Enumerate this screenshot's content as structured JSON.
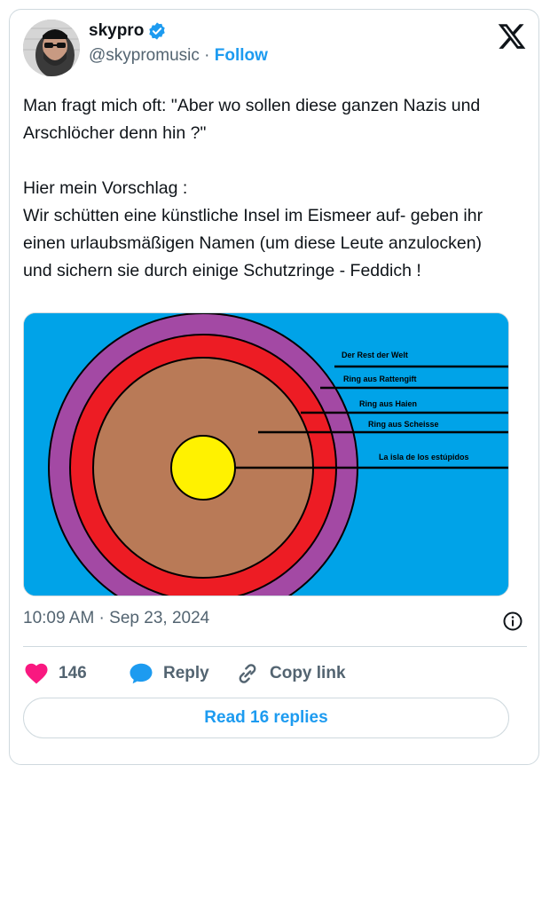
{
  "author": {
    "name": "skypro",
    "handle": "@skypromusic",
    "separator": "·",
    "follow_label": "Follow"
  },
  "tweet": {
    "text": "Man fragt mich oft: \"Aber wo sollen diese ganzen Nazis und Arschlöcher denn hin ?\"\n\nHier mein Vorschlag :\nWir schütten eine künstliche Insel im Eismeer auf- geben ihr einen urlaubsmäßigen Namen (um diese Leute anzulocken) und sichern sie durch einige Schutzringe - Feddich !",
    "timestamp": "10:09 AM · Sep 23, 2024"
  },
  "media": {
    "labels": {
      "world": "Der Rest der Welt",
      "rat_poison": "Ring aus Rattengift",
      "sharks": "Ring aus Haien",
      "shit": "Ring aus Scheisse",
      "island": "La isla de los estúpidos"
    },
    "colors": {
      "sea": "#00a3e8",
      "purple": "#a349a4",
      "red": "#ed1c24",
      "brown": "#b97a57",
      "yellow": "#fff200"
    }
  },
  "actions": {
    "likes": "146",
    "reply_label": "Reply",
    "copy_label": "Copy link",
    "read_replies_label": "Read 16 replies"
  },
  "colors": {
    "accent": "#1d9bf0",
    "like": "#f91880",
    "muted": "#536471"
  },
  "icons": {
    "verified": "verified-badge-icon",
    "logo": "x-logo-icon",
    "info": "info-icon",
    "like": "heart-icon",
    "reply": "speech-bubble-icon",
    "copy": "link-icon"
  }
}
